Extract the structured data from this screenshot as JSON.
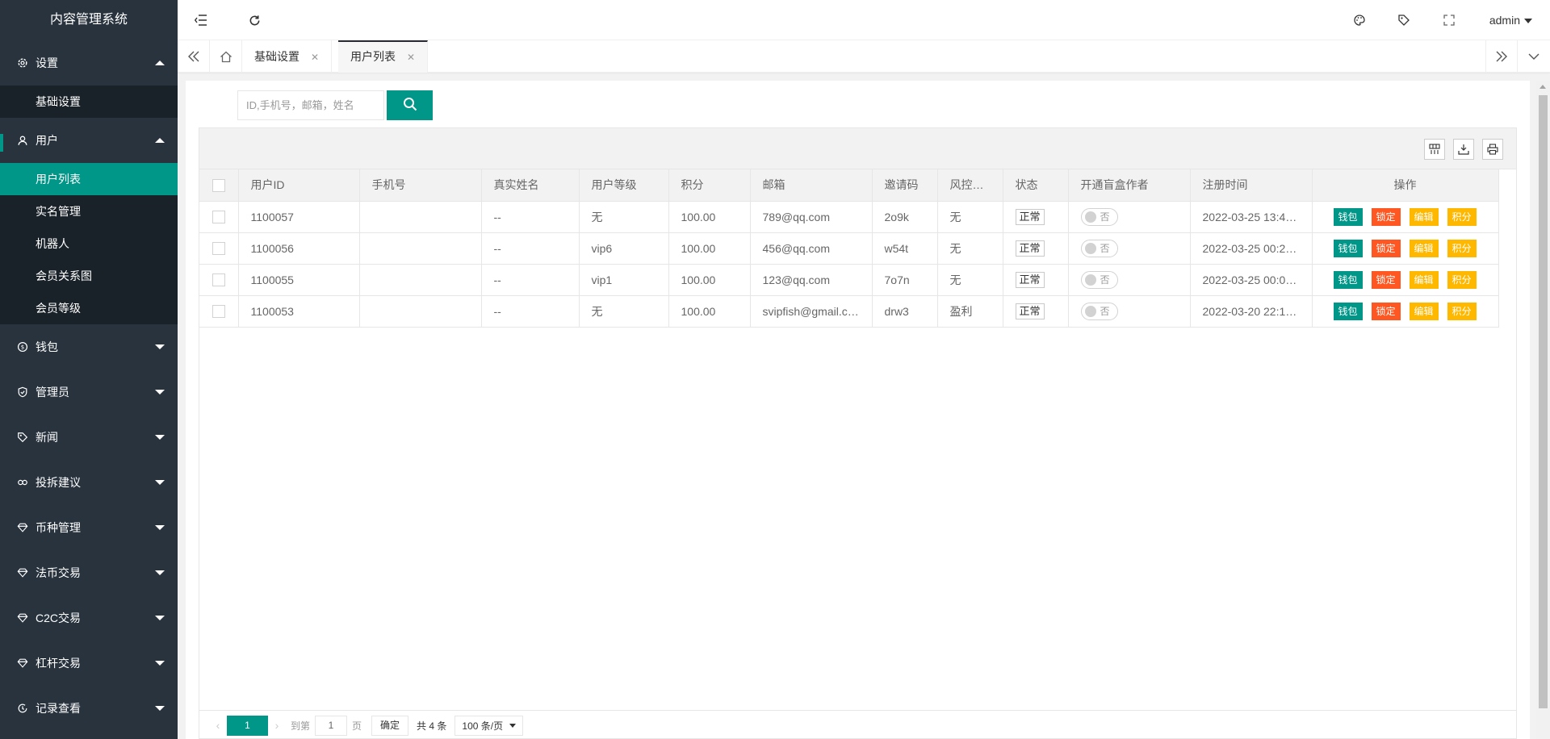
{
  "app": {
    "title": "内容管理系统"
  },
  "sidebar": {
    "groups": [
      {
        "label": "设置",
        "expanded": true,
        "items": [
          "基础设置"
        ]
      },
      {
        "label": "用户",
        "expanded": true,
        "items": [
          "用户列表",
          "实名管理",
          "机器人",
          "会员关系图",
          "会员等级"
        ],
        "active_item": "用户列表"
      },
      {
        "label": "钱包",
        "expanded": false
      },
      {
        "label": "管理员",
        "expanded": false
      },
      {
        "label": "新闻",
        "expanded": false
      },
      {
        "label": "投拆建议",
        "expanded": false
      },
      {
        "label": "币种管理",
        "expanded": false
      },
      {
        "label": "法币交易",
        "expanded": false
      },
      {
        "label": "C2C交易",
        "expanded": false
      },
      {
        "label": "杠杆交易",
        "expanded": false
      },
      {
        "label": "记录查看",
        "expanded": false
      }
    ]
  },
  "header": {
    "user": "admin"
  },
  "tabs": [
    {
      "label": "基础设置",
      "active": false
    },
    {
      "label": "用户列表",
      "active": true
    }
  ],
  "search": {
    "placeholder": "ID,手机号，邮箱，姓名",
    "value": ""
  },
  "table": {
    "columns": [
      "用户ID",
      "手机号",
      "真实姓名",
      "用户等级",
      "积分",
      "邮箱",
      "邀请码",
      "风控…",
      "状态",
      "开通盲盒作者",
      "注册时间",
      "操作"
    ],
    "rows": [
      {
        "id": "1100057",
        "phone": "",
        "name": "--",
        "level": "无",
        "points": "100.00",
        "email": "789@qq.com",
        "invite": "2o9k",
        "risk": "无",
        "status": "正常",
        "blindbox": "否",
        "time": "2022-03-25 13:4…"
      },
      {
        "id": "1100056",
        "phone": "",
        "name": "--",
        "level": "vip6",
        "points": "100.00",
        "email": "456@qq.com",
        "invite": "w54t",
        "risk": "无",
        "status": "正常",
        "blindbox": "否",
        "time": "2022-03-25 00:2…"
      },
      {
        "id": "1100055",
        "phone": "",
        "name": "--",
        "level": "vip1",
        "points": "100.00",
        "email": "123@qq.com",
        "invite": "7o7n",
        "risk": "无",
        "status": "正常",
        "blindbox": "否",
        "time": "2022-03-25 00:0…"
      },
      {
        "id": "1100053",
        "phone": "",
        "name": "--",
        "level": "无",
        "points": "100.00",
        "email": "svipfish@gmail.c…",
        "invite": "drw3",
        "risk": "盈利",
        "status": "正常",
        "blindbox": "否",
        "time": "2022-03-20 22:1…"
      }
    ],
    "actions": [
      "钱包",
      "锁定",
      "编辑",
      "积分"
    ]
  },
  "pager": {
    "current": "1",
    "goto_label": "到第",
    "goto_value": "1",
    "page_unit": "页",
    "confirm": "确定",
    "total": "共 4 条",
    "page_size": "100 条/页"
  },
  "colors": {
    "accent": "#009688",
    "danger": "#ff5722",
    "warn": "#ffb800",
    "sidebar": "#28333e"
  }
}
